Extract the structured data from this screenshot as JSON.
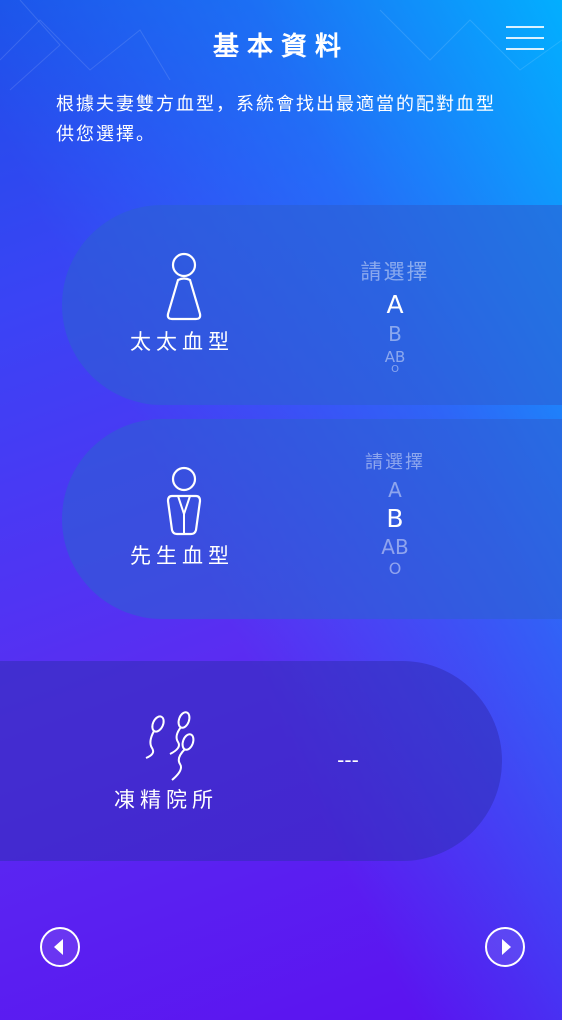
{
  "header": {
    "title": "基本資料",
    "menu_icon": "hamburger-menu-icon"
  },
  "intro_text": "根據夫妻雙方血型，系統會找出最適當的配對血型供您選擇。",
  "wife": {
    "label": "太太血型",
    "icon": "woman-icon",
    "picker": {
      "placeholder": "請選擇",
      "options": [
        "A",
        "B",
        "AB",
        "O"
      ],
      "selected": "A"
    }
  },
  "husband": {
    "label": "先生血型",
    "icon": "man-icon",
    "picker": {
      "placeholder": "請選擇",
      "options": [
        "A",
        "B",
        "AB",
        "O"
      ],
      "selected": "B"
    }
  },
  "clinic": {
    "label": "凍精院所",
    "icon": "sperm-icon",
    "value": "---"
  },
  "footer": {
    "prev_icon": "play-left-icon",
    "next_icon": "play-right-icon"
  }
}
